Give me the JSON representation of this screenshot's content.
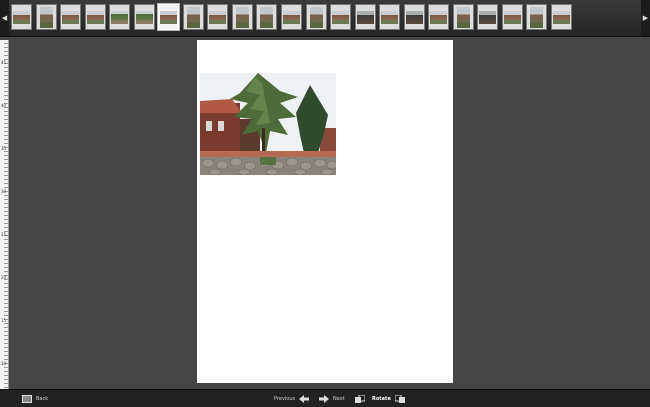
{
  "strip": {
    "thumbnails": [
      "",
      "",
      "",
      "",
      "",
      "",
      "",
      "",
      "",
      "",
      "",
      "",
      "",
      "",
      "",
      "",
      "",
      "",
      "",
      "",
      "",
      "",
      ""
    ],
    "selected_index": 6
  },
  "ruler": {
    "numbers": [
      "45",
      "40",
      "35",
      "30",
      "25",
      "20",
      "15",
      "10"
    ]
  },
  "toolbar": {
    "back_label": "Back",
    "previous_label": "Previous",
    "next_label": "Next",
    "rotate_label": "Rotate"
  },
  "icons": {
    "back": "list-icon",
    "previous": "arrow-left-icon",
    "next": "arrow-right-icon",
    "rotate_left": "rotate-left-icon",
    "rotate_right": "rotate-right-icon",
    "strip_left": "chevron-left-icon",
    "strip_right": "chevron-right-icon"
  },
  "colors": {
    "background": "#454545",
    "bar": "#222222",
    "page": "#ffffff"
  }
}
